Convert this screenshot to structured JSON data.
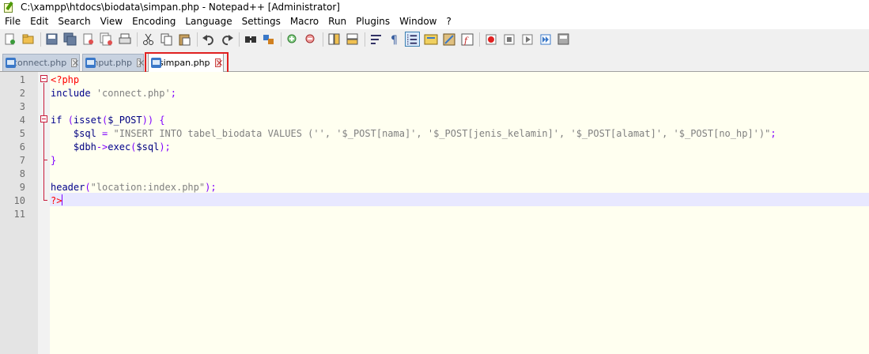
{
  "window": {
    "title": "C:\\xampp\\htdocs\\biodata\\simpan.php - Notepad++ [Administrator]"
  },
  "menu": [
    "File",
    "Edit",
    "Search",
    "View",
    "Encoding",
    "Language",
    "Settings",
    "Macro",
    "Run",
    "Plugins",
    "Window",
    "?"
  ],
  "tabs": [
    {
      "label": "connect.php",
      "active": false
    },
    {
      "label": "input.php",
      "active": false
    },
    {
      "label": "simpan.php",
      "active": true
    }
  ],
  "editor": {
    "line_numbers": [
      "1",
      "2",
      "3",
      "4",
      "5",
      "6",
      "7",
      "8",
      "9",
      "10",
      "11"
    ],
    "current_line": 10,
    "lines": [
      [
        {
          "t": "php",
          "v": "<?php"
        }
      ],
      [
        {
          "t": "kw",
          "v": "include"
        },
        {
          "t": "def",
          "v": " "
        },
        {
          "t": "str",
          "v": "'connect.php'"
        },
        {
          "t": "op",
          "v": ";"
        }
      ],
      [],
      [
        {
          "t": "kw",
          "v": "if"
        },
        {
          "t": "def",
          "v": " "
        },
        {
          "t": "op",
          "v": "("
        },
        {
          "t": "fn",
          "v": "isset"
        },
        {
          "t": "op",
          "v": "("
        },
        {
          "t": "var",
          "v": "$_POST"
        },
        {
          "t": "op",
          "v": "))"
        },
        {
          "t": "def",
          "v": " "
        },
        {
          "t": "op",
          "v": "{"
        }
      ],
      [
        {
          "t": "def",
          "v": "    "
        },
        {
          "t": "var",
          "v": "$sql"
        },
        {
          "t": "def",
          "v": " "
        },
        {
          "t": "op",
          "v": "="
        },
        {
          "t": "def",
          "v": " "
        },
        {
          "t": "str",
          "v": "\"INSERT INTO tabel_biodata VALUES ('', '$_POST[nama]', '$_POST[jenis_kelamin]', '$_POST[alamat]', '$_POST[no_hp]')\""
        },
        {
          "t": "op",
          "v": ";"
        }
      ],
      [
        {
          "t": "def",
          "v": "    "
        },
        {
          "t": "var",
          "v": "$dbh"
        },
        {
          "t": "op",
          "v": "->"
        },
        {
          "t": "fn",
          "v": "exec"
        },
        {
          "t": "op",
          "v": "("
        },
        {
          "t": "var",
          "v": "$sql"
        },
        {
          "t": "op",
          "v": ");"
        }
      ],
      [
        {
          "t": "op",
          "v": "}"
        }
      ],
      [],
      [
        {
          "t": "fn",
          "v": "header"
        },
        {
          "t": "op",
          "v": "("
        },
        {
          "t": "str",
          "v": "\"location:index.php\""
        },
        {
          "t": "op",
          "v": ");"
        }
      ],
      [
        {
          "t": "php",
          "v": "?>"
        }
      ],
      []
    ]
  },
  "toolbar_icons": [
    "new-file-icon",
    "open-file-icon",
    "save-icon",
    "save-all-icon",
    "close-icon",
    "close-all-icon",
    "print-icon",
    "cut-icon",
    "copy-icon",
    "paste-icon",
    "undo-icon",
    "redo-icon",
    "find-icon",
    "replace-icon",
    "zoom-in-icon",
    "zoom-out-icon",
    "sync-vertical-icon",
    "sync-horizontal-icon",
    "word-wrap-icon",
    "show-all-chars-icon",
    "indent-guide-icon",
    "user-defined-language-icon",
    "document-map-icon",
    "function-list-icon",
    "record-macro-icon",
    "stop-recording-icon",
    "playback-macro-icon",
    "run-macro-multiple-icon",
    "save-macro-icon"
  ],
  "colors": {
    "highlight_box": "#e02020",
    "active_tab_accent": "#f6a000",
    "code_background": "#fffff0",
    "current_line": "#e8e8ff"
  }
}
